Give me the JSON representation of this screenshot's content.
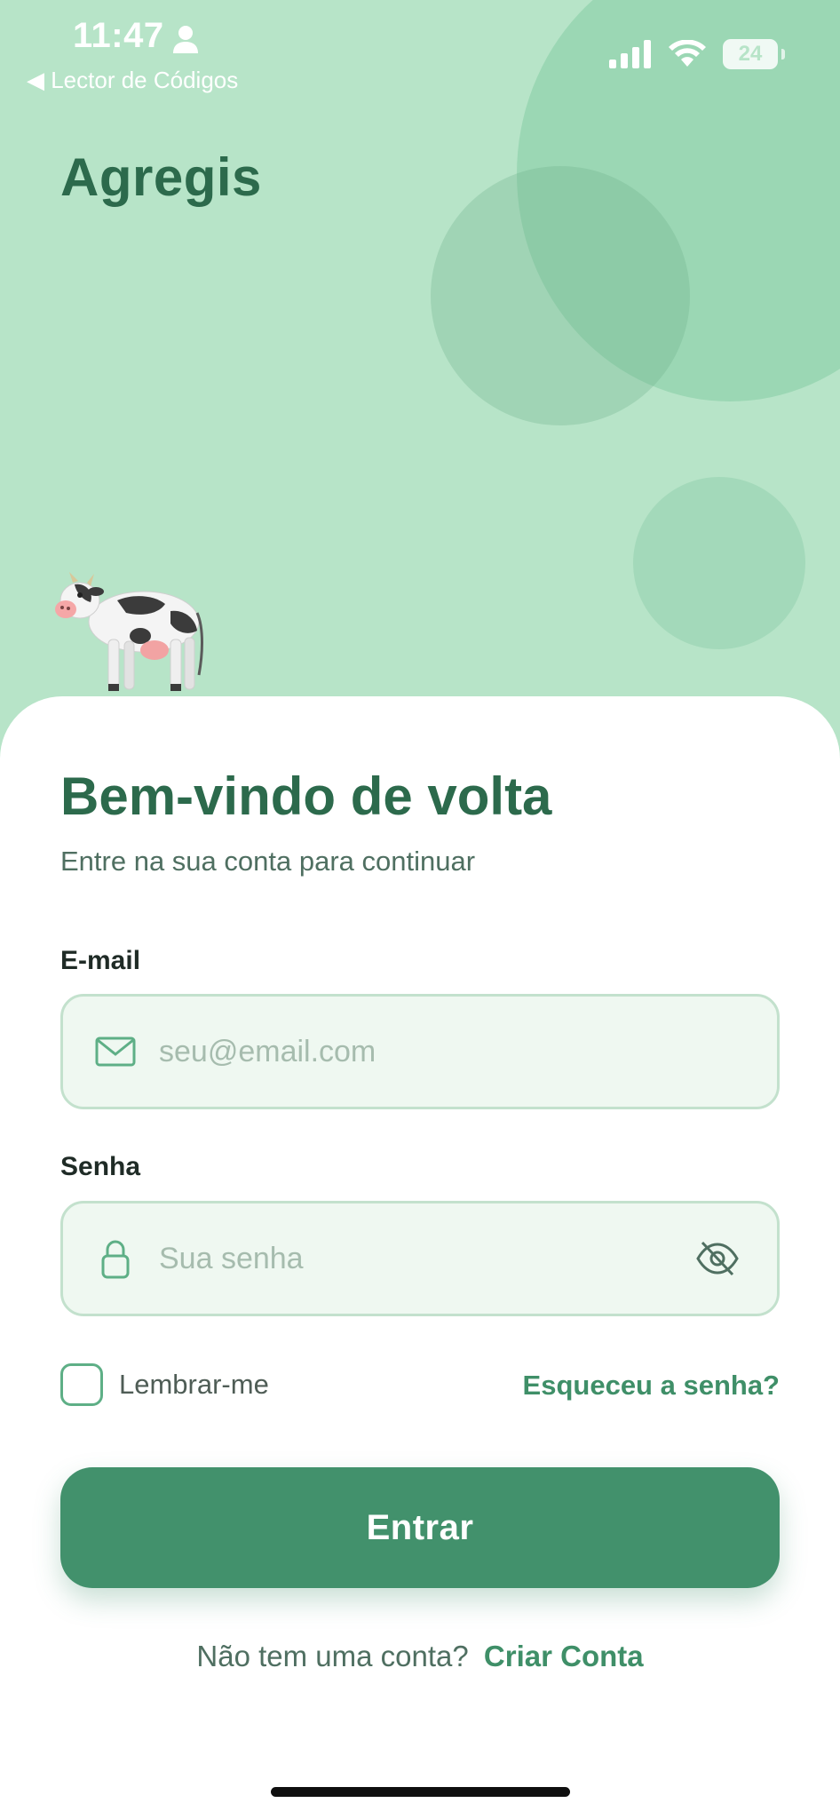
{
  "status_bar": {
    "time": "11:47",
    "back_app": "◀ Lector de Códigos",
    "battery": "24",
    "icons": [
      "person-icon",
      "signal-icon",
      "wifi-icon",
      "battery-icon"
    ]
  },
  "header": {
    "app_name": "Agregis",
    "mascot": "cow-icon"
  },
  "login": {
    "title": "Bem-vindo de volta",
    "subtitle": "Entre na sua conta para continuar",
    "email_label": "E-mail",
    "email_placeholder": "seu@email.com",
    "email_value": "",
    "password_label": "Senha",
    "password_placeholder": "Sua senha",
    "password_value": "",
    "remember_label": "Lembrar-me",
    "remember_checked": false,
    "forgot_label": "Esqueceu a senha?",
    "submit_label": "Entrar",
    "signup_prompt": "Não tem uma conta?",
    "signup_link": "Criar Conta"
  },
  "colors": {
    "background": "#b7e4c8",
    "primary": "#42916c",
    "title": "#2c6a4c",
    "input_bg": "#eff8f1"
  }
}
